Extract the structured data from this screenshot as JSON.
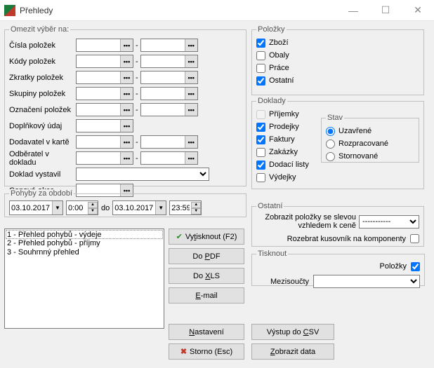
{
  "window": {
    "title": "Přehledy"
  },
  "limit": {
    "legend": "Omezit výběr na:",
    "rows": {
      "cisla": "Čísla položek",
      "kody": "Kódy položek",
      "zkratky": "Zkratky položek",
      "skupiny": "Skupiny položek",
      "oznaceni": "Označení položek",
      "doplnkovy": "Doplňkový údaj",
      "dodavatel": "Dodavatel v kartě",
      "odberatel": "Odběratel v dokladu",
      "doklad": "Doklad vystavil",
      "cenova": "Cenová akce"
    },
    "dash": "-"
  },
  "polozky": {
    "legend": "Položky",
    "zbozi": "Zboží",
    "obaly": "Obaly",
    "prace": "Práce",
    "ostatni": "Ostatní"
  },
  "doklady": {
    "legend": "Doklady",
    "prijemky": "Příjemky",
    "prodejky": "Prodejky",
    "faktury": "Faktury",
    "zakazky": "Zakázky",
    "dodaci": "Dodací listy",
    "vydejky": "Výdejky"
  },
  "stav": {
    "legend": "Stav",
    "uzavrene": "Uzavřené",
    "rozpracovane": "Rozpracované",
    "stornovane": "Stornované"
  },
  "pohyby": {
    "legend": "Pohyby za období",
    "from": "03.10.2017",
    "timeFrom": "0:00",
    "do": "do",
    "to": "03.10.2017",
    "timeTo": "23:59"
  },
  "ostatni": {
    "legend": "Ostatní",
    "sleva": "Zobrazit položky se slevou vzhledem k ceně",
    "rozebrat": "Rozebrat kusovník na komponenty",
    "slevaSel": "-----------"
  },
  "tisknout": {
    "legend": "Tisknout",
    "polozkyLbl": "Položky",
    "mezisoucty": "Mezisoučty"
  },
  "list": {
    "i1": "1 - Přehled pohybů - výdeje",
    "i2": "2 - Přehled pohybů - příjmy",
    "i3": "3 - Souhrnný přehled"
  },
  "buttons": {
    "vytisknout_pre": "Vy",
    "vytisknout_u": "t",
    "vytisknout_post": "isknout (F2)",
    "dopdf_pre": "Do ",
    "dopdf_u": "P",
    "dopdf_post": "DF",
    "doxls_pre": "Do ",
    "doxls_u": "X",
    "doxls_post": "LS",
    "email_pre": "",
    "email_u": "E",
    "email_post": "-mail",
    "nast_pre": "",
    "nast_u": "N",
    "nast_post": "astavení",
    "storno_pre": "Storno (",
    "storno_u": "",
    "storno_post": "Esc)",
    "csv_pre": "Výstup do ",
    "csv_u": "C",
    "csv_post": "SV",
    "zobraz_pre": "",
    "zobraz_u": "Z",
    "zobraz_post": "obrazit data"
  }
}
